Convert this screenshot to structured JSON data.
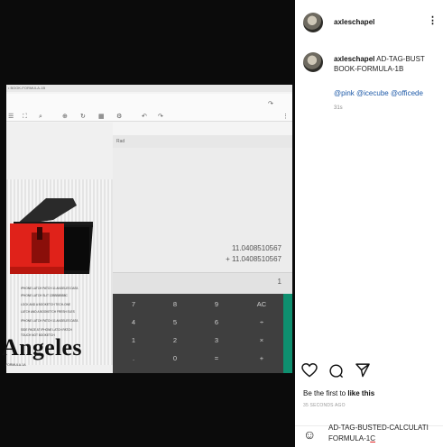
{
  "media": {
    "window_title": "• BOOK-FORMULA-1B",
    "toolbar_icons": [
      "☰",
      "⛶",
      "⌕",
      "⊕",
      "↻",
      "▦",
      "⚙",
      "↶",
      "↷",
      "↷",
      "⋮"
    ],
    "angeles": "Angeles",
    "angeles_sub": "FORMULA-1A",
    "doc_lines": [
      "IPHONE LATCH PATCH 11 ANGELES DATA",
      "IPHONE LATCH SLIT 12BBB8BB8C",
      "LOCK AND A BOOKETCH TECH-ONE",
      "LATCH AND A BOOKETCH FRESH ELES",
      "IPHONE LATCH PATCH 11 ANGELES DATA",
      "SIDE PAGE AT IPHONE LATCH PATCH",
      "TOUCH NOT BOOKETCH"
    ],
    "calculator": {
      "mode": "Rad",
      "result_line1": "11.0408510567",
      "result_line2": "+ 11.0408510567",
      "input_value": "1",
      "keys": [
        [
          "7",
          "8",
          "9",
          "AC"
        ],
        [
          "4",
          "5",
          "6",
          "÷"
        ],
        [
          "1",
          "2",
          "3",
          "×"
        ],
        [
          ".",
          "0",
          "=",
          "+"
        ]
      ]
    }
  },
  "post": {
    "username": "axleschapel",
    "caption_user": "axleschapel",
    "caption_text_1": "AD-TAG-BUST",
    "caption_text_2": "BOOK-FORMULA-1B",
    "mentions": "@pink @icecube @officede",
    "caption_time": "31s",
    "likes_prefix": "Be the first to ",
    "likes_link": "like this",
    "timestamp": "35 SECONDS AGO",
    "comment_text_1": "AD-TAG-BUSTED-CALCULATI",
    "comment_text_2": "FORMULA-1",
    "comment_text_3": "C",
    "more_icon": "⋮",
    "emoji_icon": "☺"
  },
  "colors": {
    "accent_teal": "#0e8f6f",
    "device_red": "#e0221a",
    "mention_blue": "#1e5aa8"
  }
}
